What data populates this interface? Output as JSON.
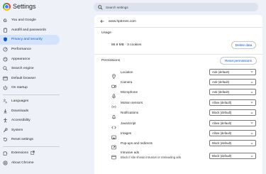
{
  "app": {
    "title": "Settings"
  },
  "search": {
    "placeholder": "Search settings"
  },
  "sidebar": {
    "items": [
      {
        "label": "You and Google",
        "icon": "google-icon"
      },
      {
        "label": "Autofill and passwords",
        "icon": "clipboard-icon"
      },
      {
        "label": "Privacy and security",
        "icon": "shield-icon",
        "active": true
      },
      {
        "label": "Performance",
        "icon": "gauge-icon"
      },
      {
        "label": "Appearance",
        "icon": "palette-icon"
      },
      {
        "label": "Search engine",
        "icon": "search-icon"
      },
      {
        "label": "Default browser",
        "icon": "browser-icon"
      },
      {
        "label": "On startup",
        "icon": "power-icon"
      },
      {
        "label": "Languages",
        "icon": "translate-icon"
      },
      {
        "label": "Downloads",
        "icon": "download-icon"
      },
      {
        "label": "Accessibility",
        "icon": "accessibility-icon"
      },
      {
        "label": "System",
        "icon": "wrench-icon"
      },
      {
        "label": "Reset settings",
        "icon": "reset-icon"
      },
      {
        "label": "Extensions",
        "icon": "puzzle-icon"
      },
      {
        "label": "About Chrome",
        "icon": "chrome-icon"
      }
    ]
  },
  "site": {
    "url": "www.hp5mes.com"
  },
  "usage": {
    "title": "Usage",
    "text": "86.9 MB · 3 cookies",
    "delete_label": "Delete data"
  },
  "permissions": {
    "title": "Permissions",
    "reset_label": "Reset permissions",
    "rows": [
      {
        "label": "Location",
        "value": "Ask (default)",
        "icon": "location-icon"
      },
      {
        "label": "Camera",
        "value": "Ask (default)",
        "icon": "camera-icon"
      },
      {
        "label": "Microphone",
        "value": "Ask (default)",
        "icon": "microphone-icon"
      },
      {
        "label": "Motion sensors",
        "value": "Allow (default)",
        "icon": "motion-sensor-icon"
      },
      {
        "label": "Notifications",
        "value": "Block (default)",
        "icon": "bell-icon"
      },
      {
        "label": "JavaScript",
        "value": "Allow (default)",
        "icon": "code-icon"
      },
      {
        "label": "Images",
        "value": "Allow (default)",
        "icon": "image-icon"
      },
      {
        "label": "Pop-ups and redirects",
        "value": "Block (default)",
        "icon": "popup-icon"
      },
      {
        "label": "Intrusive ads",
        "sub": "Block if site shows intrusive or misleading ads",
        "value": "Block (default)",
        "icon": "ads-icon"
      }
    ]
  },
  "colors": {
    "accent": "#0b57d0",
    "active_bg": "#d3e3fd",
    "page_bg": "#eef1f7"
  }
}
